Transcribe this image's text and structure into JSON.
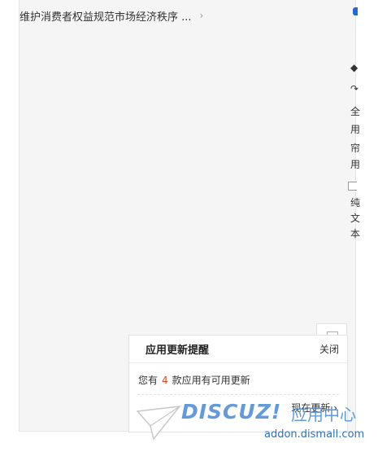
{
  "breadcrumb": {
    "title": "维护消费者权益规范市场经济秩序 ...",
    "chevron": "›"
  },
  "right_rail": {
    "glyphs": [
      "◆",
      "↷",
      "全",
      "用",
      "帘",
      "用",
      "纯",
      "文",
      "本"
    ]
  },
  "update_panel": {
    "title": "应用更新提醒",
    "close_label": "关闭",
    "message_prefix": "您有",
    "count": "4",
    "message_suffix": "款应用有可用更新",
    "update_now_label": "现在更新 ›"
  },
  "watermark": {
    "brand": "DISCUZ!",
    "brand_cn": "应用中心",
    "url": "addon.dismall.com"
  },
  "colors": {
    "accent": "#1e6bd6",
    "count_highlight": "#e0451a",
    "frame_background": "#f5f5f5"
  }
}
